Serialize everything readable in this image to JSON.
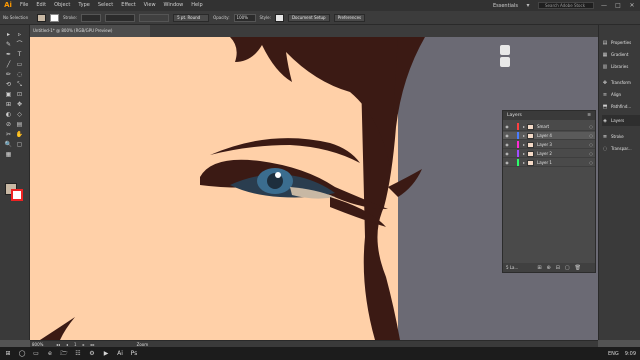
{
  "app": {
    "logo": "Ai"
  },
  "menus": [
    "File",
    "Edit",
    "Object",
    "Type",
    "Select",
    "Effect",
    "View",
    "Window",
    "Help"
  ],
  "menubar_right": {
    "workspace": "Essentials",
    "search_placeholder": "Search Adobe Stock",
    "workspace_chevron": "▾",
    "icons": {
      "bridge": "bridge-icon",
      "gpu": "gpu-icon"
    }
  },
  "window_controls": {
    "minimize": "—",
    "maximize": "□",
    "close": "✕"
  },
  "control_bar": {
    "selection": "No Selection",
    "stroke_label": "Stroke:",
    "brush": "5 pt. Round",
    "opacity_label": "Opacity:",
    "opacity_value": "100%",
    "style_label": "Style:",
    "doc_setup": "Document Setup",
    "preferences": "Preferences",
    "fill_color": "#c8b8a4",
    "stroke_color": "#ffffff"
  },
  "document_tab": {
    "title": "Untitled-1* @ 800% (RGB/GPU Preview)",
    "close": "✕"
  },
  "tools": [
    "▸",
    "▹",
    "✎",
    "⌒",
    "✒",
    "T",
    "╱",
    "▭",
    "✏",
    "◌",
    "⟲",
    "⤡",
    "▣",
    "⊡",
    "⊞",
    "✥",
    "◐",
    "◇",
    "⊘",
    "▤",
    "✂",
    "✋",
    "🔍",
    "▢",
    "▦"
  ],
  "right_dock": [
    {
      "icon": "▤",
      "label": "Properties"
    },
    {
      "icon": "▦",
      "label": "Gradient"
    },
    {
      "icon": "▥",
      "label": "Libraries"
    },
    {
      "icon": "✥",
      "label": "Transform"
    },
    {
      "icon": "≡",
      "label": "Align"
    },
    {
      "icon": "⬒",
      "label": "Pathfind..."
    },
    {
      "icon": "◈",
      "label": "Layers"
    },
    {
      "icon": "≣",
      "label": "Stroke"
    },
    {
      "icon": "◌",
      "label": "Transpar..."
    }
  ],
  "layers_panel": {
    "title": "Layers",
    "menu": "≡",
    "layers": [
      {
        "name": "Smart",
        "color": "#ff4040",
        "selected": false
      },
      {
        "name": "Layer 4",
        "color": "#4a7dff",
        "selected": true
      },
      {
        "name": "Layer 3",
        "color": "#ff2bd6",
        "selected": false
      },
      {
        "name": "Layer 2",
        "color": "#a14dff",
        "selected": false
      },
      {
        "name": "Layer 1",
        "color": "#2bff6a",
        "selected": false
      }
    ],
    "count": "5 La...",
    "footer_buttons": [
      "⊞",
      "⊕",
      "⊟",
      "▢",
      "🗑"
    ]
  },
  "status": {
    "zoom": "800%",
    "tool": "Zoom",
    "nav": [
      "◂◂",
      "◂",
      "1",
      "▸",
      "▸▸"
    ]
  },
  "taskbar": {
    "apps": [
      "⊞",
      "◯",
      "▭",
      "e",
      "🗁",
      "☷",
      "⚙",
      "▶",
      "Ai",
      "Ps"
    ],
    "lang": "ENG",
    "time": "9:09"
  },
  "colors": {
    "skin": "#ffd0a8",
    "hair": "#3b1a14",
    "iris": "#3b6d8f",
    "bg_grey": "#6b6a74",
    "accent": "#ff9a00"
  }
}
